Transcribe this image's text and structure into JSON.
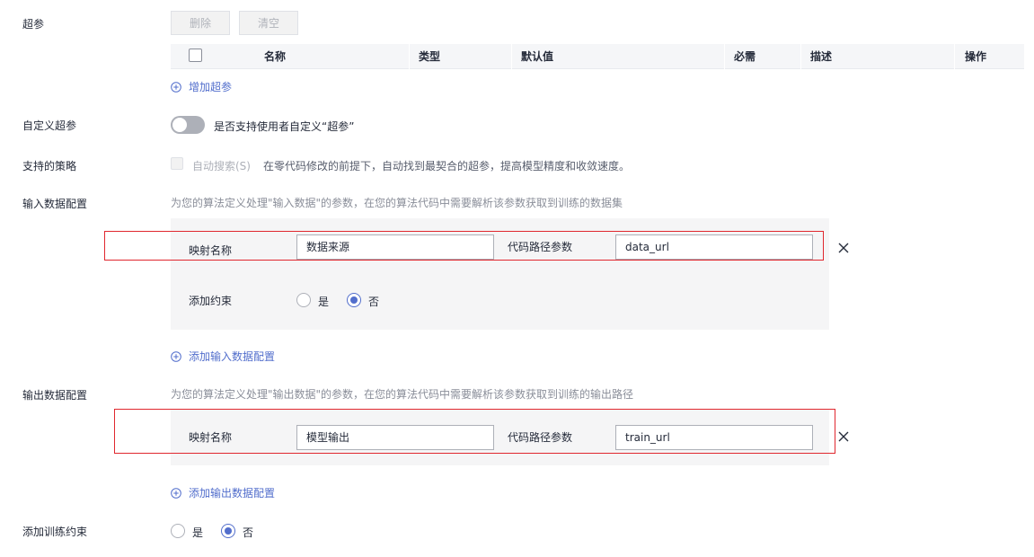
{
  "hyperparams": {
    "label": "超参",
    "delete_btn": "删除",
    "clear_btn": "清空",
    "columns": [
      "名称",
      "类型",
      "默认值",
      "必需",
      "描述",
      "操作"
    ],
    "add_link": "增加超参"
  },
  "custom_hyperparams": {
    "label": "自定义超参",
    "toggle_text": "是否支持使用者自定义“超参”",
    "toggle_on": false
  },
  "strategy": {
    "label": "支持的策略",
    "checkbox_label": "自动搜索(S)",
    "description": "在零代码修改的前提下，自动找到最契合的超参，提高模型精度和收敛速度。"
  },
  "input_config": {
    "label": "输入数据配置",
    "hint": "为您的算法定义处理\"输入数据\"的参数，在您的算法代码中需要解析该参数获取到训练的数据集",
    "map_name_label": "映射名称",
    "map_name_value": "数据来源",
    "code_path_label": "代码路径参数",
    "code_path_value": "data_url",
    "constraint_label": "添加约束",
    "yes": "是",
    "no": "否",
    "add_link": "添加输入数据配置"
  },
  "output_config": {
    "label": "输出数据配置",
    "hint": "为您的算法定义处理\"输出数据\"的参数，在您的算法代码中需要解析该参数获取到训练的输出路径",
    "map_name_label": "映射名称",
    "map_name_value": "模型输出",
    "code_path_label": "代码路径参数",
    "code_path_value": "train_url",
    "add_link": "添加输出数据配置"
  },
  "train_constraint": {
    "label": "添加训练约束",
    "yes": "是",
    "no": "否"
  },
  "colors": {
    "accent": "#526ecc",
    "highlight_border": "#e0272e"
  }
}
